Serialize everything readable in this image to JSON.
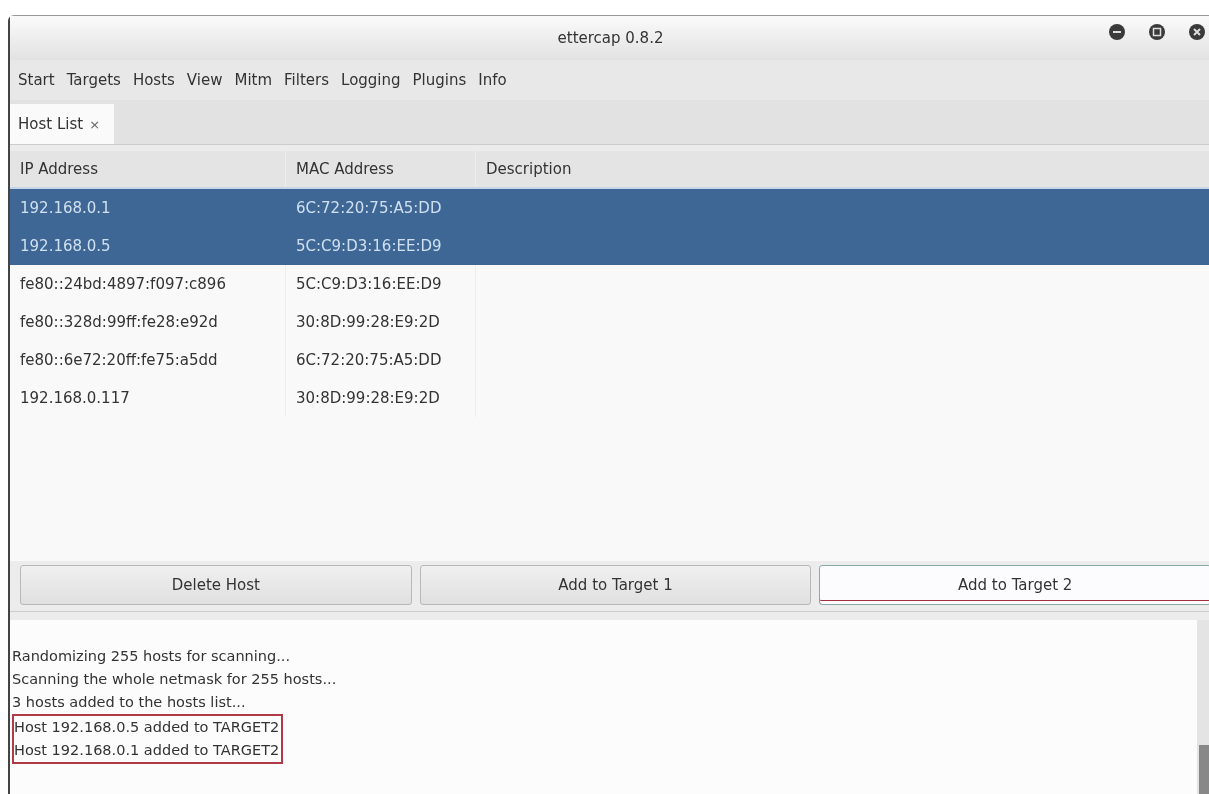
{
  "window": {
    "title": "ettercap 0.8.2"
  },
  "menu": [
    "Start",
    "Targets",
    "Hosts",
    "View",
    "Mitm",
    "Filters",
    "Logging",
    "Plugins",
    "Info"
  ],
  "tabs": [
    {
      "label": "Host List",
      "close": "×",
      "selected": true
    }
  ],
  "table": {
    "columns": [
      "IP Address",
      "MAC Address",
      "Description"
    ],
    "rows": [
      {
        "cells": [
          "192.168.0.1",
          "6C:72:20:75:A5:DD"
        ],
        "selected": true
      },
      {
        "cells": [
          "192.168.0.5",
          "5C:C9:D3:16:EE:D9"
        ],
        "selected": true
      },
      {
        "cells": [
          "fe80::24bd:4897:f097:c896",
          "5C:C9:D3:16:EE:D9"
        ],
        "selected": false
      },
      {
        "cells": [
          "fe80::328d:99ff:fe28:e92d",
          "30:8D:99:28:E9:2D"
        ],
        "selected": false
      },
      {
        "cells": [
          "fe80::6e72:20ff:fe75:a5dd",
          "6C:72:20:75:A5:DD"
        ],
        "selected": false
      },
      {
        "cells": [
          "192.168.0.117",
          "30:8D:99:28:E9:2D"
        ],
        "selected": false
      }
    ]
  },
  "buttons": [
    {
      "label": "Delete Host",
      "focused": false
    },
    {
      "label": "Add to Target 1",
      "focused": false
    },
    {
      "label": "Add to Target 2",
      "focused": true
    }
  ],
  "log": [
    {
      "text": "Randomizing 255 hosts for scanning...",
      "highlighted": false
    },
    {
      "text": "Scanning the whole netmask for 255 hosts...",
      "highlighted": false
    },
    {
      "text": "3 hosts added to the hosts list...",
      "highlighted": false
    },
    {
      "text": "Host 192.168.0.5 added to TARGET2",
      "highlighted": true
    },
    {
      "text": "Host 192.168.0.1 added to TARGET2",
      "highlighted": true
    }
  ]
}
